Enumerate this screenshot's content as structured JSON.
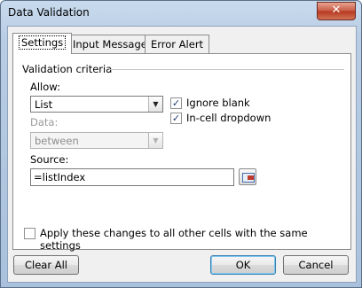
{
  "window": {
    "title": "Data Validation",
    "close_glyph": "✕"
  },
  "tabs": [
    {
      "label": "Settings",
      "active": true
    },
    {
      "label": "Input Message",
      "active": false
    },
    {
      "label": "Error Alert",
      "active": false
    }
  ],
  "validation": {
    "group_label": "Validation criteria",
    "allow_label": "Allow:",
    "allow_value": "List",
    "data_label": "Data:",
    "data_value": "between",
    "ignore_blank_label": "Ignore blank",
    "ignore_blank_checked": true,
    "in_cell_dropdown_label": "In-cell dropdown",
    "in_cell_dropdown_checked": true,
    "source_label": "Source:",
    "source_value": "=listIndex"
  },
  "apply_all": {
    "label": "Apply these changes to all other cells with the same settings",
    "checked": false
  },
  "buttons": {
    "clear_all": "Clear All",
    "ok": "OK",
    "cancel": "Cancel"
  },
  "glyphs": {
    "check": "✓",
    "dropdown": "▼"
  }
}
